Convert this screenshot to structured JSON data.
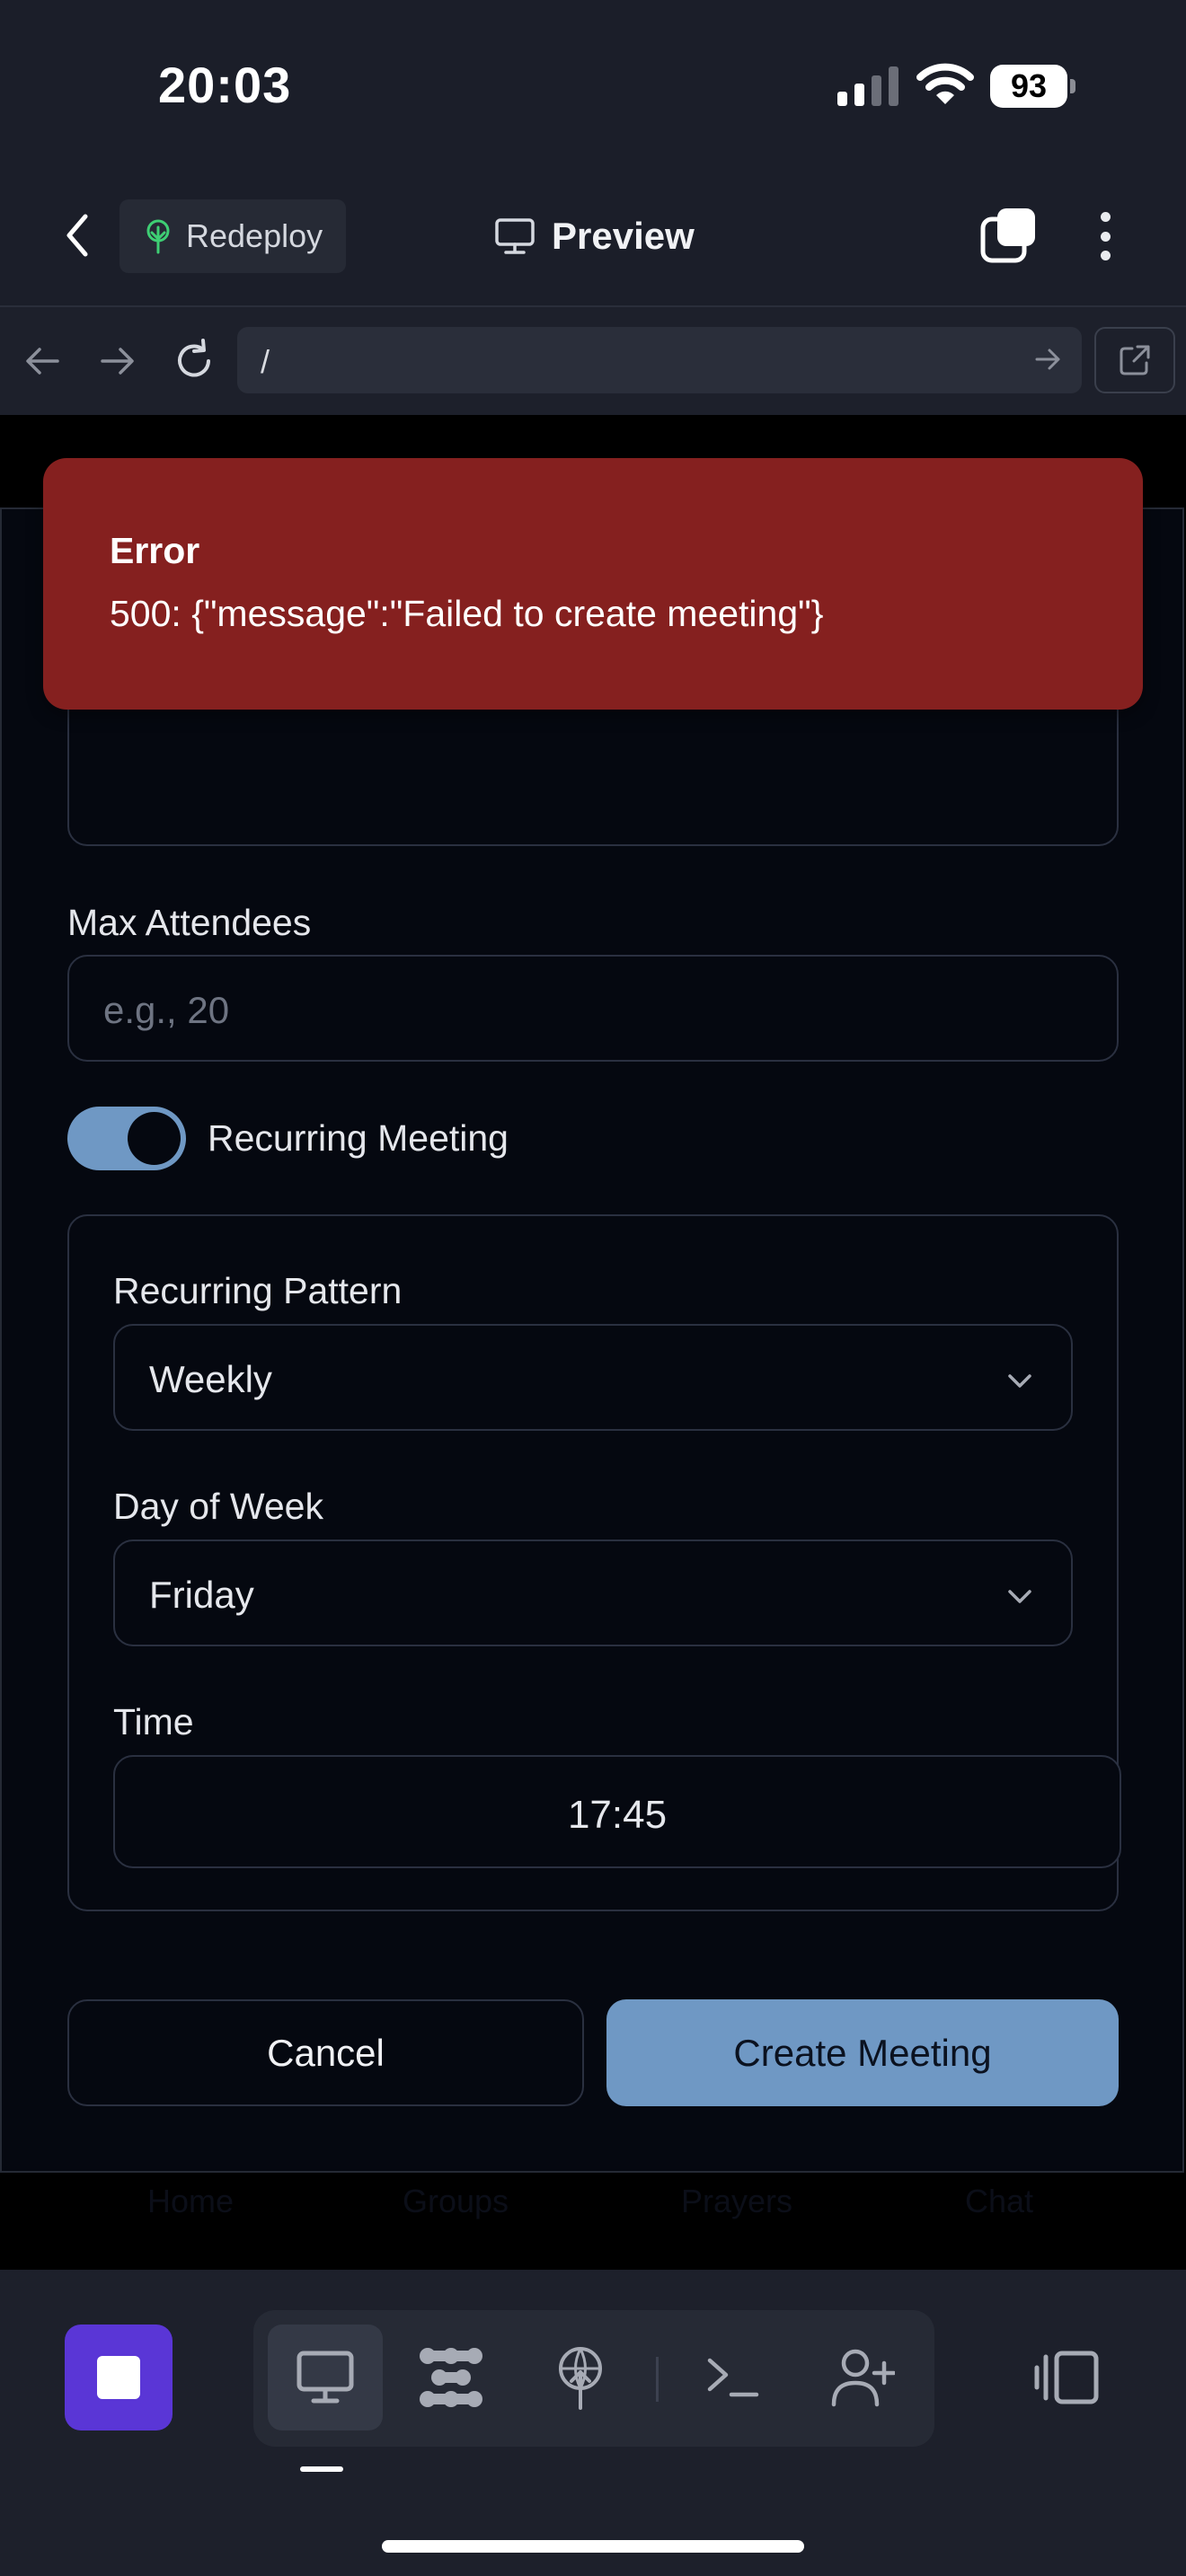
{
  "status_bar": {
    "time": "20:03",
    "battery": "93"
  },
  "header": {
    "redeploy_label": "Redeploy",
    "preview_label": "Preview"
  },
  "browser": {
    "url": "/"
  },
  "form": {
    "max_attendees_label": "Max Attendees",
    "max_attendees_placeholder": "e.g., 20",
    "recurring_toggle_label": "Recurring Meeting",
    "recurring_toggle_on": true,
    "pattern_label": "Recurring Pattern",
    "pattern_value": "Weekly",
    "day_label": "Day of Week",
    "day_value": "Friday",
    "time_label": "Time",
    "time_value": "17:45",
    "cancel_label": "Cancel",
    "create_label": "Create Meeting"
  },
  "error_toast": {
    "title": "Error",
    "message": "500: {\"message\":\"Failed to create meeting\"}"
  },
  "app_nav_ghost": [
    "Home",
    "Groups",
    "Prayers",
    "Chat"
  ],
  "colors": {
    "accent": "#6f98c4",
    "error": "#85201f",
    "stop_button": "#5a36d6",
    "page_bg": "#050810"
  },
  "icons": {
    "back": "chevron-left-icon",
    "redeploy": "tree-icon",
    "preview": "monitor-icon",
    "tabs": "tabs-icon",
    "more": "more-vertical-icon",
    "nav_back": "arrow-left-icon",
    "nav_forward": "arrow-right-icon",
    "reload": "reload-icon",
    "go": "arrow-right-icon",
    "external": "external-link-icon",
    "chevron": "chevron-down-icon",
    "stop": "stop-icon",
    "desktop": "monitor-icon",
    "apps": "apps-icon",
    "deploy": "deploy-icon",
    "shell": "terminal-icon",
    "invite": "add-user-icon",
    "panel": "panel-toggle-icon"
  }
}
